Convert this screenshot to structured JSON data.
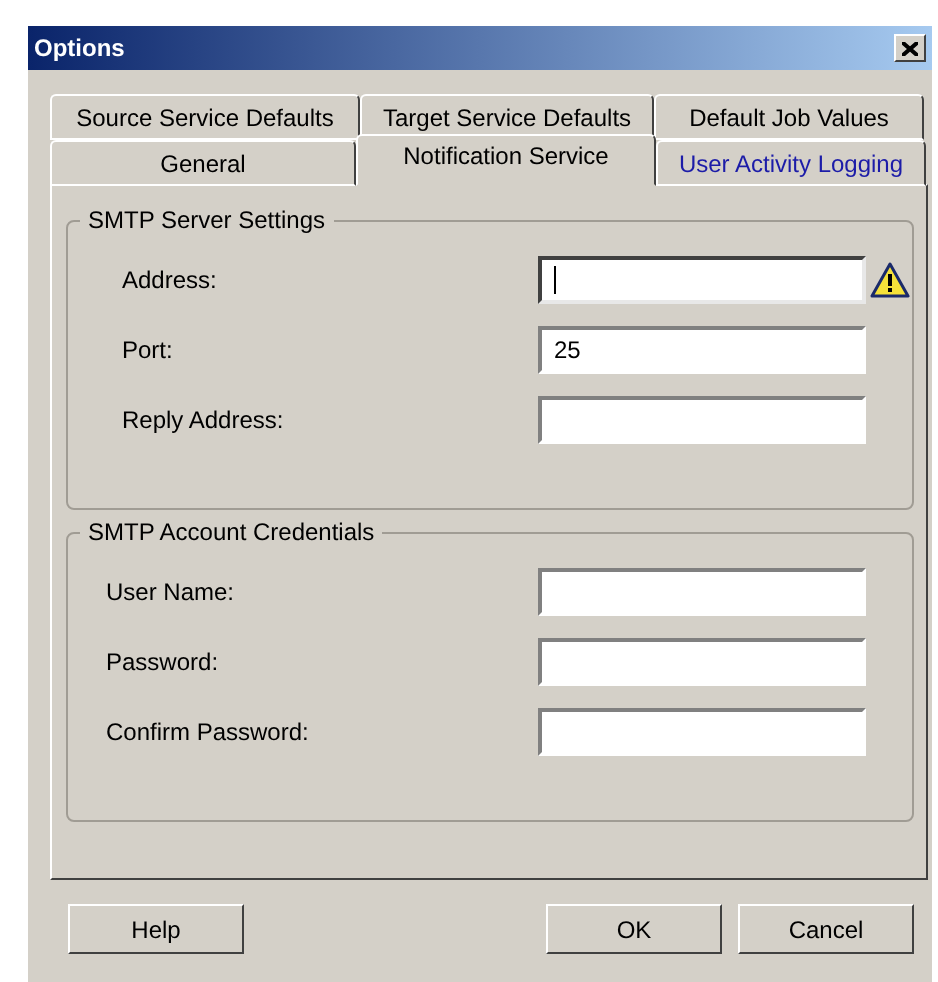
{
  "window": {
    "title": "Options"
  },
  "tab_rows": [
    [
      {
        "label": "Source Service Defaults",
        "selected": false,
        "hot": false
      },
      {
        "label": "Target Service Defaults",
        "selected": false,
        "hot": false
      },
      {
        "label": "Default Job Values",
        "selected": false,
        "hot": false
      }
    ],
    [
      {
        "label": "General",
        "selected": false,
        "hot": false
      },
      {
        "label": "Notification Service",
        "selected": true,
        "hot": false
      },
      {
        "label": "User Activity Logging",
        "selected": false,
        "hot": true
      }
    ]
  ],
  "groups": [
    {
      "title": "SMTP Server Settings",
      "fields": [
        {
          "label": "Address:",
          "focused": true,
          "warning": true
        },
        {
          "label": "Port:",
          "value": "25",
          "focused": false,
          "warning": false
        },
        {
          "label": "Reply Address:",
          "focused": false,
          "warning": false
        }
      ]
    },
    {
      "title": "SMTP Account Credentials",
      "fields": [
        {
          "label": "User Name:",
          "focused": false,
          "warning": false
        },
        {
          "label": "Password:",
          "focused": false,
          "warning": false
        },
        {
          "label": "Confirm Password:",
          "focused": false,
          "warning": false
        }
      ]
    }
  ],
  "buttons": {
    "left": [
      "Help"
    ],
    "right": [
      "OK",
      "Cancel"
    ]
  }
}
